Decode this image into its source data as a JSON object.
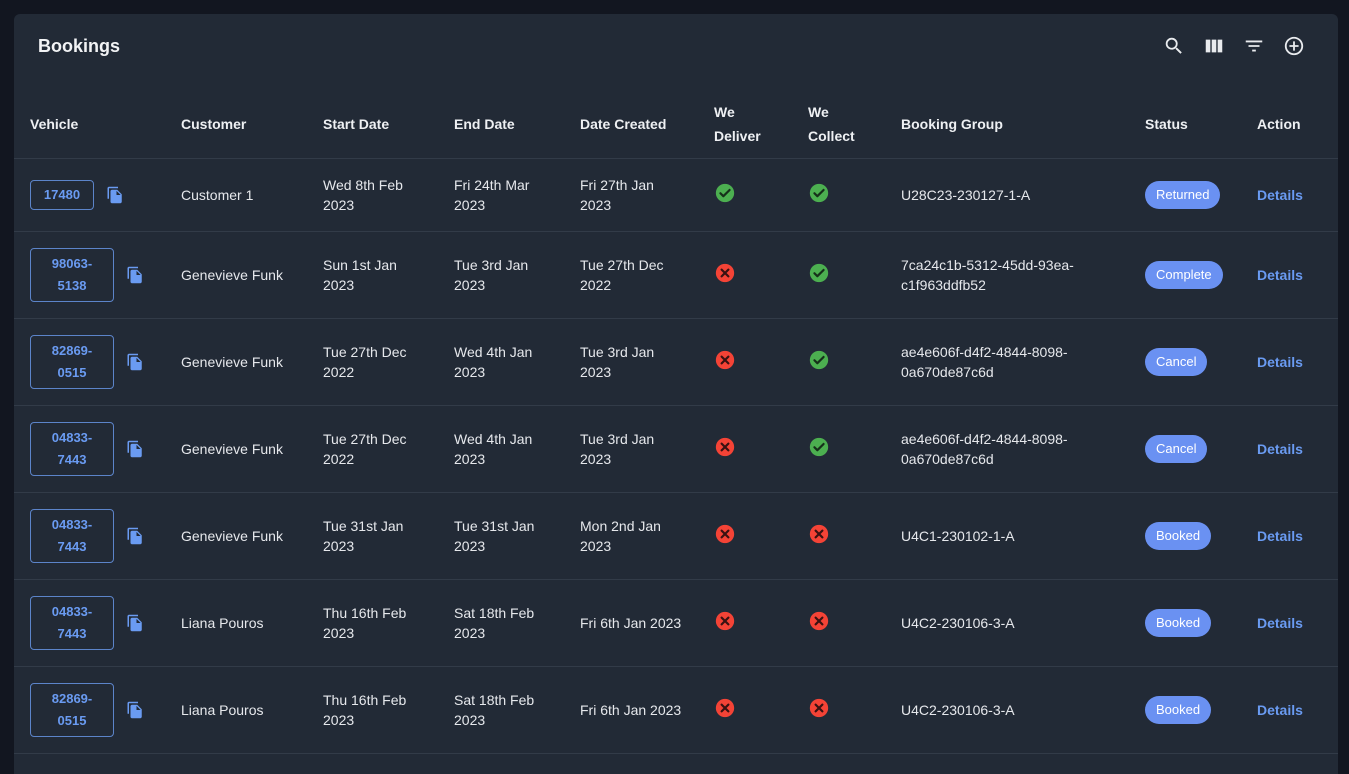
{
  "header": {
    "title": "Bookings",
    "icons": [
      "search-icon",
      "columns-icon",
      "filter-icon",
      "add-circle-icon"
    ]
  },
  "colors": {
    "accent": "#6a91f2",
    "success": "#4caf50",
    "error": "#f44336",
    "card_bg": "#222a36"
  },
  "table": {
    "columns": {
      "vehicle": "Vehicle",
      "customer": "Customer",
      "start_date": "Start Date",
      "end_date": "End Date",
      "date_created": "Date Created",
      "we_deliver_1": "We",
      "we_deliver_2": "Deliver",
      "we_collect_1": "We",
      "we_collect_2": "Collect",
      "booking_group": "Booking Group",
      "status": "Status",
      "action": "Action"
    },
    "rows": [
      {
        "vehicle_1": "17480",
        "vehicle_2": "",
        "customer": "Customer 1",
        "start_1": "Wed 8th Feb",
        "start_2": "2023",
        "end_1": "Fri 24th Mar",
        "end_2": "2023",
        "created_1": "Fri 27th Jan",
        "created_2": "2023",
        "we_deliver": true,
        "we_collect": true,
        "group_1": "U28C23-230127-1-A",
        "group_2": "",
        "status": "Returned",
        "action": "Details"
      },
      {
        "vehicle_1": "98063-",
        "vehicle_2": "5138",
        "customer": "Genevieve Funk",
        "start_1": "Sun 1st Jan",
        "start_2": "2023",
        "end_1": "Tue 3rd Jan",
        "end_2": "2023",
        "created_1": "Tue 27th Dec",
        "created_2": "2022",
        "we_deliver": false,
        "we_collect": true,
        "group_1": "7ca24c1b-5312-45dd-93ea-",
        "group_2": "c1f963ddfb52",
        "status": "Complete",
        "action": "Details"
      },
      {
        "vehicle_1": "82869-",
        "vehicle_2": "0515",
        "customer": "Genevieve Funk",
        "start_1": "Tue 27th Dec",
        "start_2": "2022",
        "end_1": "Wed 4th Jan",
        "end_2": "2023",
        "created_1": "Tue 3rd Jan",
        "created_2": "2023",
        "we_deliver": false,
        "we_collect": true,
        "group_1": "ae4e606f-d4f2-4844-8098-",
        "group_2": "0a670de87c6d",
        "status": "Cancel",
        "action": "Details"
      },
      {
        "vehicle_1": "04833-",
        "vehicle_2": "7443",
        "customer": "Genevieve Funk",
        "start_1": "Tue 27th Dec",
        "start_2": "2022",
        "end_1": "Wed 4th Jan",
        "end_2": "2023",
        "created_1": "Tue 3rd Jan",
        "created_2": "2023",
        "we_deliver": false,
        "we_collect": true,
        "group_1": "ae4e606f-d4f2-4844-8098-",
        "group_2": "0a670de87c6d",
        "status": "Cancel",
        "action": "Details"
      },
      {
        "vehicle_1": "04833-",
        "vehicle_2": "7443",
        "customer": "Genevieve Funk",
        "start_1": "Tue 31st Jan",
        "start_2": "2023",
        "end_1": "Tue 31st Jan",
        "end_2": "2023",
        "created_1": "Mon 2nd Jan",
        "created_2": "2023",
        "we_deliver": false,
        "we_collect": false,
        "group_1": "U4C1-230102-1-A",
        "group_2": "",
        "status": "Booked",
        "action": "Details"
      },
      {
        "vehicle_1": "04833-",
        "vehicle_2": "7443",
        "customer": "Liana Pouros",
        "start_1": "Thu 16th Feb",
        "start_2": "2023",
        "end_1": "Sat 18th Feb",
        "end_2": "2023",
        "created_1": "Fri 6th Jan 2023",
        "created_2": "",
        "we_deliver": false,
        "we_collect": false,
        "group_1": "U4C2-230106-3-A",
        "group_2": "",
        "status": "Booked",
        "action": "Details"
      },
      {
        "vehicle_1": "82869-",
        "vehicle_2": "0515",
        "customer": "Liana Pouros",
        "start_1": "Thu 16th Feb",
        "start_2": "2023",
        "end_1": "Sat 18th Feb",
        "end_2": "2023",
        "created_1": "Fri 6th Jan 2023",
        "created_2": "",
        "we_deliver": false,
        "we_collect": false,
        "group_1": "U4C2-230106-3-A",
        "group_2": "",
        "status": "Booked",
        "action": "Details"
      }
    ]
  }
}
